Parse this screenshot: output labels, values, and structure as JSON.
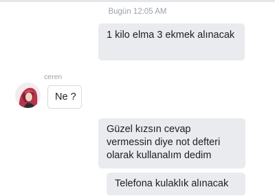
{
  "conversation": {
    "timestamp": "Bugün 12:05 AM",
    "messages": [
      {
        "direction": "outgoing",
        "text": "1 kilo elma 3 ekmek alınacak"
      },
      {
        "direction": "incoming",
        "sender": "ceren",
        "text": "Ne ?"
      },
      {
        "direction": "outgoing",
        "text": "Güzel kızsın cevap vermessin diye not defteri olarak kullanalım dedim"
      },
      {
        "direction": "outgoing",
        "text": "Telefona kulaklık alınacak"
      }
    ]
  },
  "avatar": {
    "icon": "profile-photo"
  },
  "colors": {
    "bubble_gray": "#e9ebee",
    "meta_text": "#9aa0a6",
    "message_text": "#1c1e21"
  }
}
